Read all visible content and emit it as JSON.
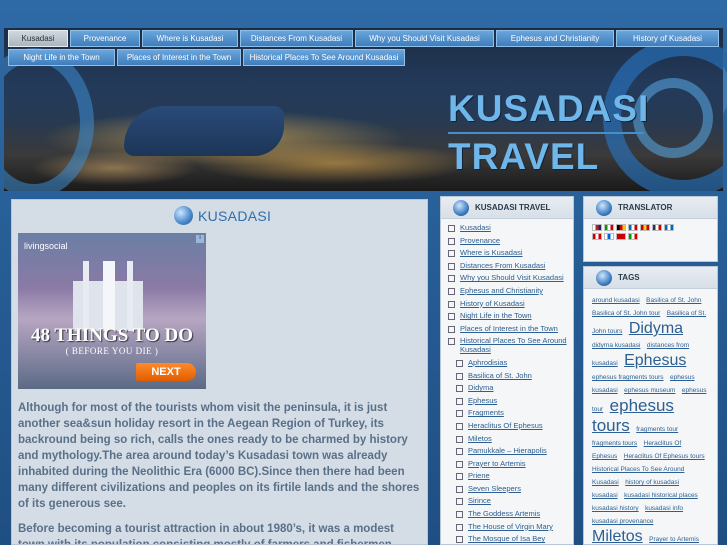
{
  "nav": {
    "row1": [
      "Kusadasi",
      "Provenance",
      "Where is Kusadasi",
      "Distances From Kusadasi",
      "Why you Should Visit Kusadasi",
      "Ephesus and Christianity",
      "History of Kusadasi"
    ],
    "row2": [
      "Night Life in the Town",
      "Places of Interest in the Town",
      "Historical Places To See Around Kusadasi"
    ],
    "active": "Kusadasi"
  },
  "banner": {
    "line1": "KUSADASI",
    "line2": "TRAVEL"
  },
  "main": {
    "title": "KUSADASI",
    "ad": {
      "brand": "livingsocial",
      "headline": "48 THINGS TO DO",
      "sub": "( BEFORE YOU DIE )",
      "button": "NEXT"
    },
    "paragraph1": "Although for most of the tourists whom visit the peninsula, it is just another sea&sun holiday resort in the Aegean Region of  Turkey, its backround being so rich, calls the ones ready to be charmed by history and mythology.The area around today’s  Kusadasi town  was already inhabited  during the Neolithic Era (6000 BC).Since then there had been many different civilizations and peoples on its firtile lands and the shores of its generous see.",
    "paragraph2": "Before becoming a tourist attraction in about 1980’s, it was a modest town with its population consisting mostly of farmers and fishermen. Within"
  },
  "kusadasi_travel": {
    "title": "KUSADASI TRAVEL",
    "items": [
      "Kusadasi",
      "Provenance",
      "Where is Kusadasi",
      "Distances From Kusadasi",
      "Why you Should Visit Kusadasi",
      "Ephesus and Christianity",
      "History of Kusadasi",
      "Night Life in the Town",
      "Places of Interest in the Town",
      "Historical Places To See Around Kusadasi"
    ],
    "subitems": [
      "Aphrodisias",
      "Basilica of St. John",
      "Didyma",
      "Ephesus",
      "Fragments",
      "Heraclitus Of Ephesus",
      "Miletos",
      "Pamukkale – Hierapolis",
      "Prayer to Artemis",
      "Priene",
      "Seven Sleepers",
      "Sirince",
      "The Goddess Artemis",
      "The House of Virgin Mary",
      "The Mosque of Isa Bey"
    ]
  },
  "translator": {
    "title": "TRANSLATOR"
  },
  "tags_panel": {
    "title": "TAGS",
    "tags": [
      {
        "t": "around kusadasi",
        "s": 1
      },
      {
        "t": "Basilica of St. John",
        "s": 1
      },
      {
        "t": "Basilica of St. John tour",
        "s": 1
      },
      {
        "t": "Basilica of St. John tours",
        "s": 1
      },
      {
        "t": "Didyma",
        "s": 4
      },
      {
        "t": "didyma kusadasi",
        "s": 1
      },
      {
        "t": "distances from kusadasi",
        "s": 1
      },
      {
        "t": "Ephesus",
        "s": 4
      },
      {
        "t": "ephesus fragments tours",
        "s": 1
      },
      {
        "t": "ephesus kusadasi",
        "s": 1
      },
      {
        "t": "ephesus museum",
        "s": 1
      },
      {
        "t": "ephesus tour",
        "s": 1
      },
      {
        "t": "ephesus tours",
        "s": 5
      },
      {
        "t": "fragments tour",
        "s": 1
      },
      {
        "t": "fragments tours",
        "s": 1
      },
      {
        "t": "Heraclitus Of Ephesus",
        "s": 1
      },
      {
        "t": "Heraclitus Of Ephesus tours",
        "s": 1
      },
      {
        "t": "Historical Places To See Around Kusadasi",
        "s": 1
      },
      {
        "t": "history of kusadasi",
        "s": 1
      },
      {
        "t": "kusadasi",
        "s": 1
      },
      {
        "t": "kusadasi historical places",
        "s": 1
      },
      {
        "t": "kusadasi history",
        "s": 1
      },
      {
        "t": "kusadasi info",
        "s": 1
      },
      {
        "t": "kusadasi provenance",
        "s": 1
      },
      {
        "t": "Miletos",
        "s": 4
      },
      {
        "t": "Prayer to Artemis",
        "s": 1
      }
    ]
  },
  "colors": {
    "link": "#2d5f92",
    "bg": "#2a5d93",
    "title": "#2f6fa9"
  }
}
